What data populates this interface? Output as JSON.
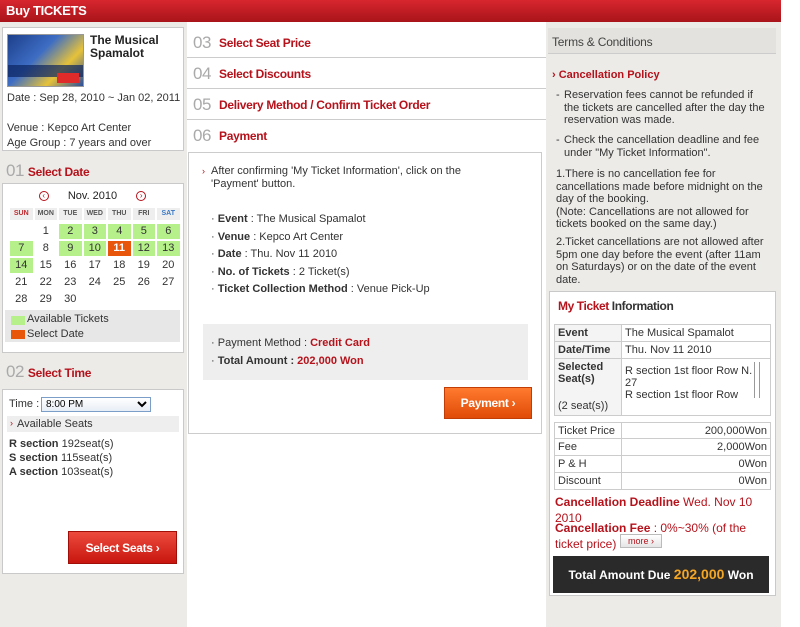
{
  "header": {
    "title": "Buy TICKETS"
  },
  "show": {
    "title": "The Musical Spamalot",
    "date": "Date : Sep 28, 2010 ~ Jan 02, 2011",
    "venue": "Venue : Kepco Art Center",
    "age": "Age Group : 7 years and over"
  },
  "steps": {
    "s01": {
      "num": "01",
      "title": "Select Date"
    },
    "s02": {
      "num": "02",
      "title": "Select Time"
    },
    "s03": {
      "num": "03",
      "title": "Select Seat Price"
    },
    "s04": {
      "num": "04",
      "title": "Select Discounts"
    },
    "s05": {
      "num": "05",
      "title": "Delivery Method / Confirm Ticket Order"
    },
    "s06": {
      "num": "06",
      "title": "Payment"
    }
  },
  "calendar": {
    "month": "Nov. 2010",
    "prev_icon": "chevron-left-icon",
    "next_icon": "chevron-right-icon",
    "weekdays": [
      "SUN",
      "MON",
      "TUE",
      "WED",
      "THU",
      "FRI",
      "SAT"
    ],
    "days": [
      "",
      "1",
      "2",
      "3",
      "4",
      "5",
      "6",
      "7",
      "8",
      "9",
      "10",
      "11",
      "12",
      "13",
      "14",
      "15",
      "16",
      "17",
      "18",
      "19",
      "20",
      "21",
      "22",
      "23",
      "24",
      "25",
      "26",
      "27",
      "28",
      "29",
      "30",
      "",
      "",
      "",
      ""
    ],
    "available": [
      "2",
      "3",
      "4",
      "5",
      "6",
      "7",
      "9",
      "10",
      "12",
      "13",
      "14"
    ],
    "selected": "11",
    "legend_available": "Available Tickets",
    "legend_selected": "Select Date",
    "colors": {
      "available": "#b6f08a",
      "selected": "#e8560c"
    }
  },
  "time": {
    "label": "Time :",
    "selected": "8:00 PM",
    "available_label": "Available Seats",
    "sections": [
      {
        "name": "R section",
        "seats": "192seat(s)"
      },
      {
        "name": "S section",
        "seats": "115seat(s)"
      },
      {
        "name": "A section",
        "seats": "103seat(s)"
      }
    ],
    "button": "Select Seats"
  },
  "payment": {
    "instruction": "After confirming 'My Ticket Information', click on the 'Payment' button.",
    "details": [
      {
        "k": "Event",
        "v": " : The Musical Spamalot"
      },
      {
        "k": "Venue",
        "v": " : Kepco Art Center"
      },
      {
        "k": "Date",
        "v": " : Thu. Nov 11 2010"
      },
      {
        "k": "No. of Tickets",
        "v": " : 2 Ticket(s)"
      },
      {
        "k": "Ticket Collection Method",
        "v": " : Venue Pick-Up"
      }
    ],
    "method_label": "Payment Method : ",
    "method_value": "Credit Card",
    "total_label": "Total Amount : ",
    "total_value": "202,000 Won",
    "button": "Payment"
  },
  "terms": {
    "title": "Terms & Conditions",
    "policy_title": "Cancellation Policy",
    "bullets": [
      "Reservation fees cannot be refunded if the tickets are cancelled after the day the reservation was made.",
      "Check the cancellation deadline and fee under \"My Ticket Information\"."
    ],
    "numbered": [
      "1.There is no cancellation fee for cancellations made before midnight on the day of the booking.\n(Note: Cancellations are not allowed for tickets booked on the same day.)",
      "2.Ticket cancellations are not allowed after 5pm one day before the event (after 11am on Saturdays) or on the date of the event date."
    ]
  },
  "my_ticket": {
    "title_a": "My Ticket",
    "title_b": " Information",
    "event_k": "Event",
    "event_v": "The Musical Spamalot",
    "date_k": "Date/Time",
    "date_v": "Thu. Nov 11 2010",
    "seat_k": "Selected Seat(s)",
    "seat_count": "(2 seat(s))",
    "seat_lines": [
      "R section 1st floor Row N. 27",
      "R section 1st floor Row"
    ],
    "prices": [
      {
        "k": "Ticket Price",
        "v": "200,000Won"
      },
      {
        "k": "Fee",
        "v": "2,000Won"
      },
      {
        "k": "P & H",
        "v": "0Won"
      },
      {
        "k": "Discount",
        "v": "0Won"
      }
    ],
    "deadline_label": "Cancellation Deadline",
    "deadline_value": " Wed. Nov 10 2010",
    "fee_label": "Cancellation Fee",
    "fee_value": " : 0%~30% (of the ticket price)",
    "more": "more",
    "total_label": "Total Amount Due",
    "total_amount": "202,000",
    "total_unit": "Won"
  }
}
